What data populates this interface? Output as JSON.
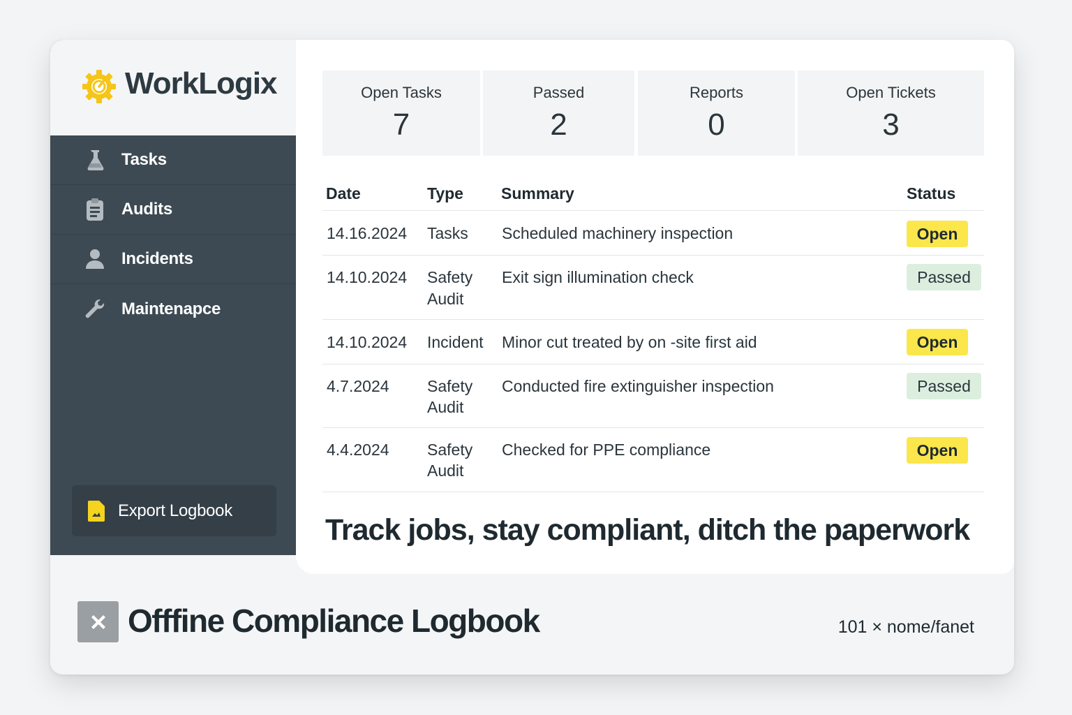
{
  "brand": {
    "name": "WorkLogix",
    "accent": "#f5c518"
  },
  "sidebar": {
    "items": [
      {
        "label": "Tasks",
        "icon": "flask-icon"
      },
      {
        "label": "Audits",
        "icon": "clipboard-icon"
      },
      {
        "label": "Incidents",
        "icon": "person-icon"
      },
      {
        "label": "Maintenapce",
        "icon": "wrench-icon"
      }
    ],
    "export_label": "Export Logbook",
    "export_icon": "document-icon"
  },
  "stats": [
    {
      "label": "Open Tasks",
      "value": "7"
    },
    {
      "label": "Passed",
      "value": "2"
    },
    {
      "label": "Reports",
      "value": "0"
    },
    {
      "label": "Open Tickets",
      "value": "3"
    }
  ],
  "table": {
    "headers": {
      "date": "Date",
      "type": "Type",
      "summary": "Summary",
      "status": "Status"
    },
    "rows": [
      {
        "date": "14.16.2024",
        "type": [
          "Tasks"
        ],
        "summary": "Scheduled machinery inspection",
        "status": "Open"
      },
      {
        "date": "14.10.2024",
        "type": [
          "Safety",
          "Audit"
        ],
        "summary": "Exit sign illumination check",
        "status": "Passed"
      },
      {
        "date": "14.10.2024",
        "type": [
          "Incident"
        ],
        "summary": "Minor cut treated by on -site first aid",
        "status": "Open"
      },
      {
        "date": "4.7.2024",
        "type": [
          "Safety",
          "Audit"
        ],
        "summary": "Conducted fire extinguisher inspection",
        "status": "Passed"
      },
      {
        "date": "4.4.2024",
        "type": [
          "Safety",
          "Audit"
        ],
        "summary": "Checked for PPE compliance",
        "status": "Open"
      }
    ],
    "status_colors": {
      "Open": "#fbe64c",
      "Passed": "#dcefdf"
    }
  },
  "tagline": "Track jobs, stay compliant, ditch the paperwork",
  "footer": {
    "title": "Offfine Compliance Logbook",
    "meta": "101 × nome/fanet",
    "icon": "close-icon"
  }
}
